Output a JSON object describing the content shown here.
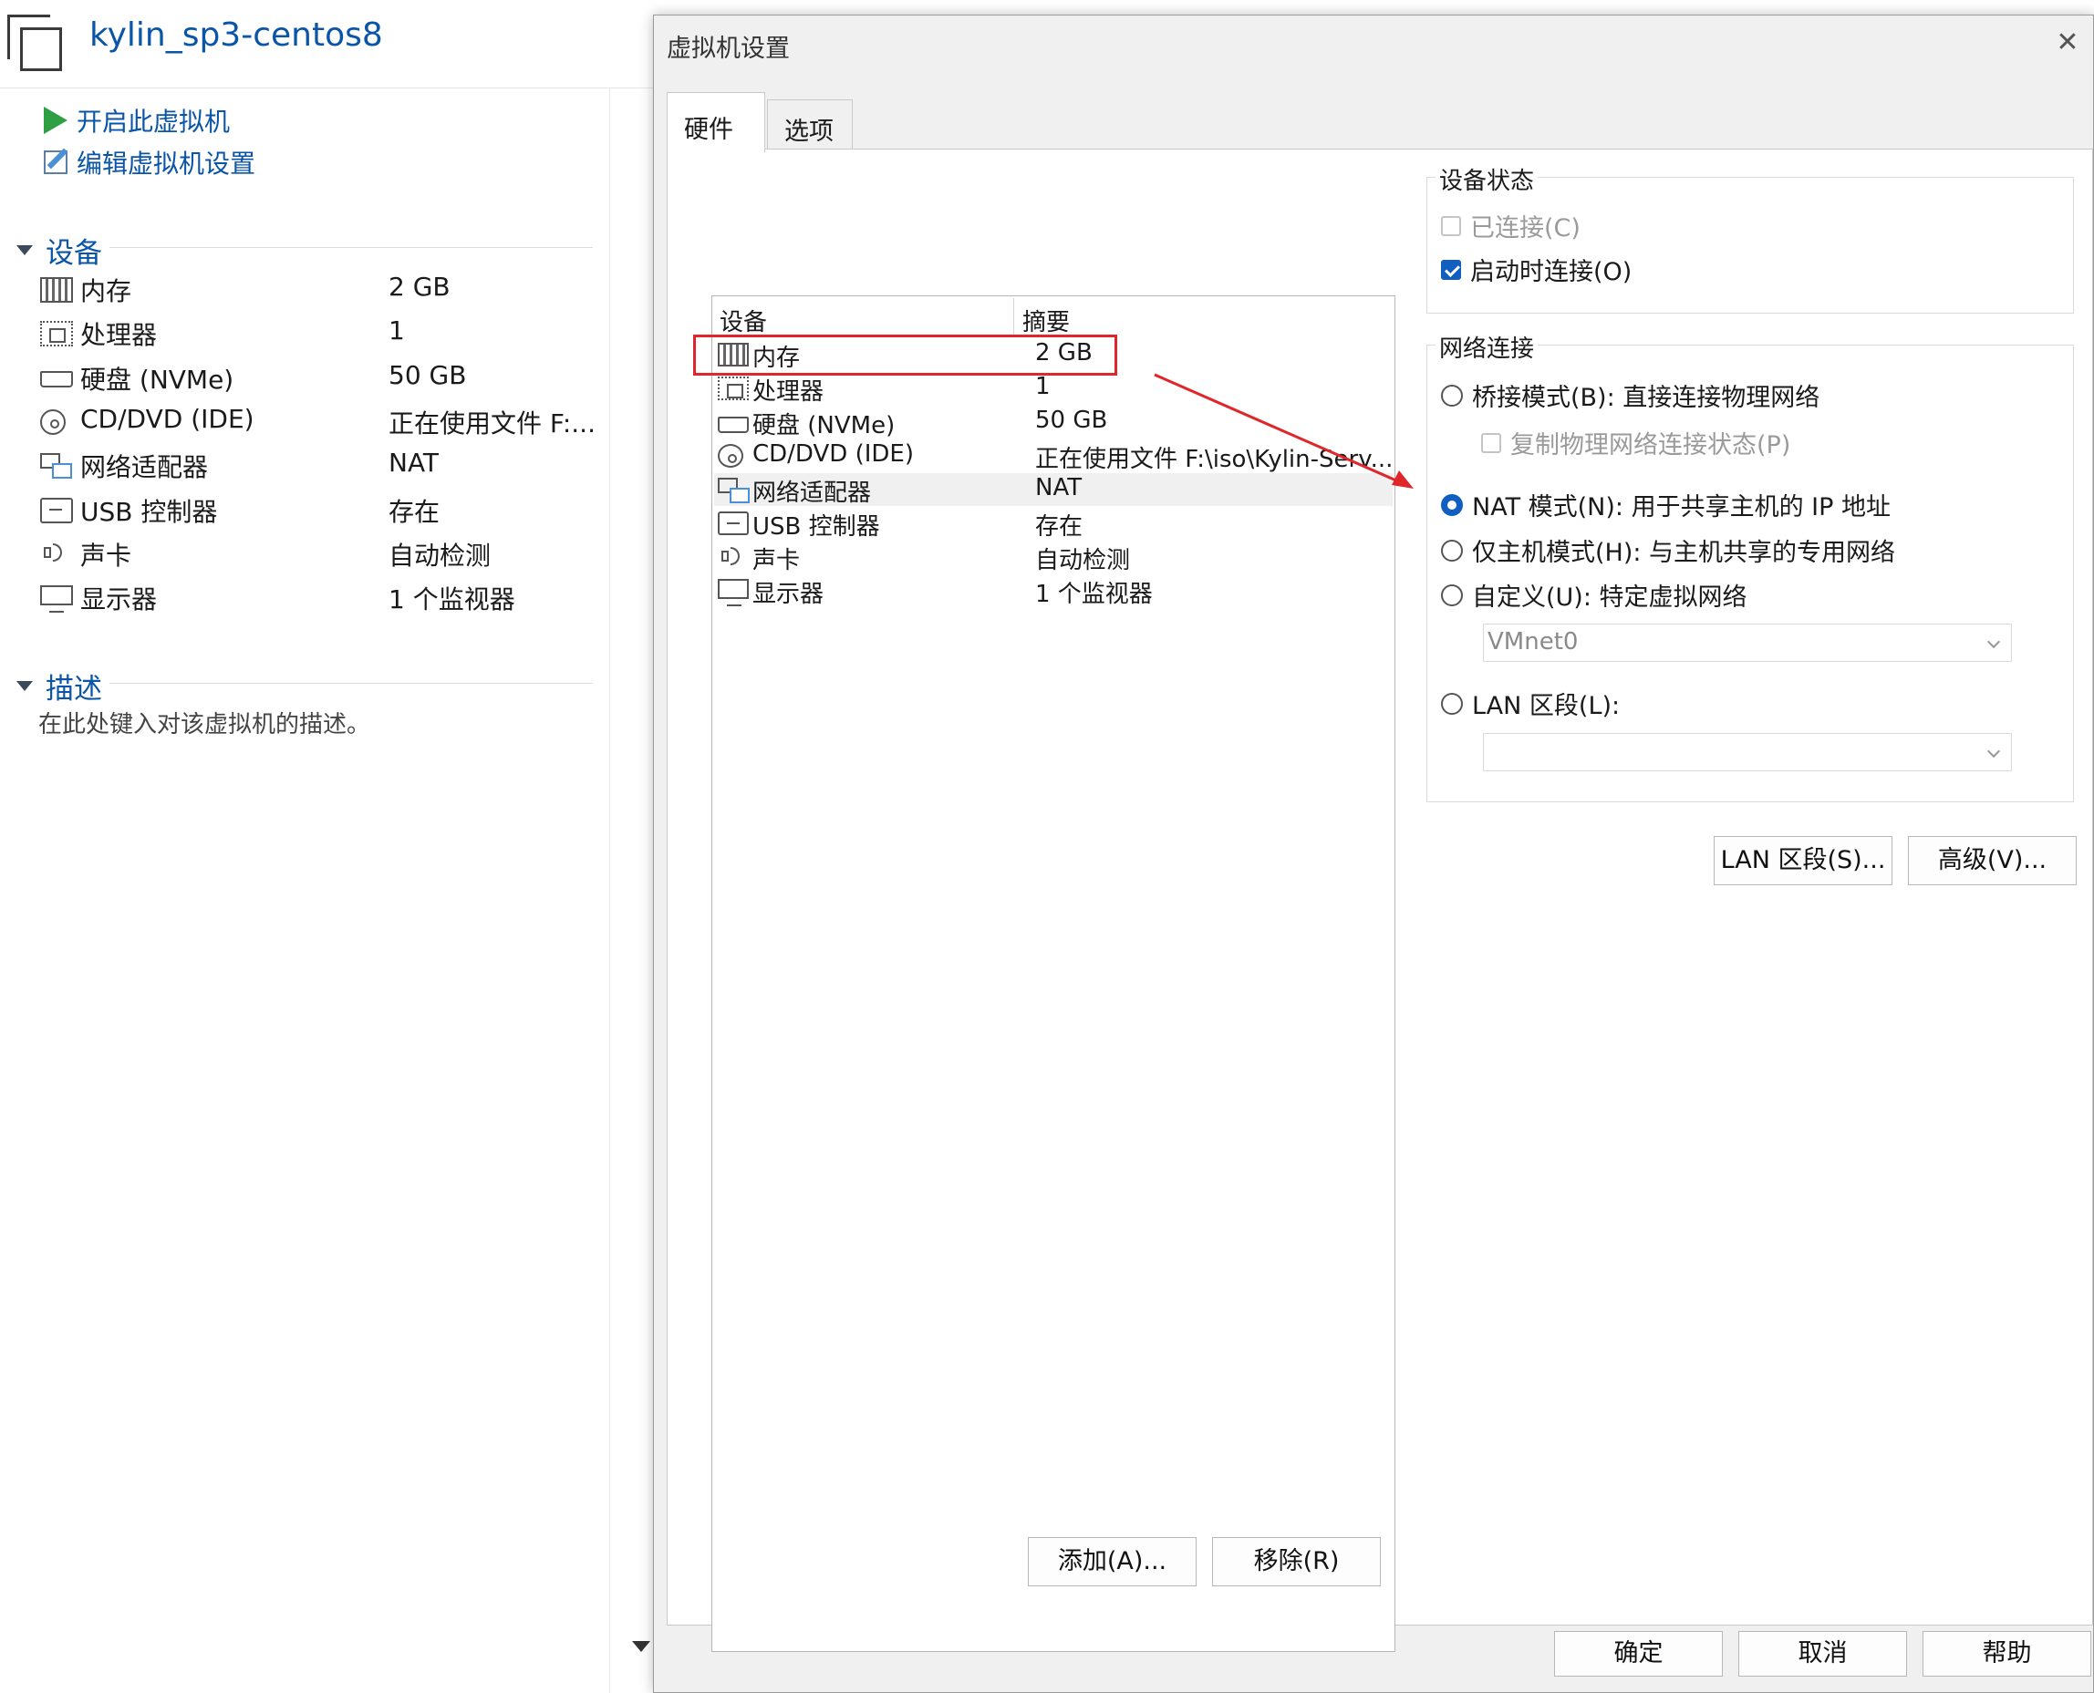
{
  "vm": {
    "title": "kylin_sp3-centos8",
    "actions": {
      "power_on": "开启此虚拟机",
      "edit_settings": "编辑虚拟机设置"
    }
  },
  "left": {
    "devices_heading": "设备",
    "devices": [
      {
        "icon": "memory-icon",
        "name": "内存",
        "value": "2 GB"
      },
      {
        "icon": "processor-icon",
        "name": "处理器",
        "value": "1"
      },
      {
        "icon": "hard-disk-icon",
        "name": "硬盘 (NVMe)",
        "value": "50 GB"
      },
      {
        "icon": "cd-dvd-icon",
        "name": "CD/DVD (IDE)",
        "value": "正在使用文件 F:..."
      },
      {
        "icon": "network-adapter-icon",
        "name": "网络适配器",
        "value": "NAT"
      },
      {
        "icon": "usb-icon",
        "name": "USB 控制器",
        "value": "存在"
      },
      {
        "icon": "sound-card-icon",
        "name": "声卡",
        "value": "自动检测"
      },
      {
        "icon": "display-icon",
        "name": "显示器",
        "value": "1 个监视器"
      }
    ],
    "description_heading": "描述",
    "description_placeholder": "在此处键入对该虚拟机的描述。"
  },
  "dialog": {
    "title": "虚拟机设置",
    "close_glyph": "✕",
    "tabs": [
      {
        "label": "硬件",
        "active": true
      },
      {
        "label": "选项",
        "active": false
      }
    ],
    "device_list": {
      "headers": {
        "device": "设备",
        "summary": "摘要"
      },
      "rows": [
        {
          "icon": "memory-icon",
          "name": "内存",
          "summary": "2 GB",
          "selected": false
        },
        {
          "icon": "processor-icon",
          "name": "处理器",
          "summary": "1",
          "selected": false
        },
        {
          "icon": "hard-disk-icon",
          "name": "硬盘 (NVMe)",
          "summary": "50 GB",
          "selected": false
        },
        {
          "icon": "cd-dvd-icon",
          "name": "CD/DVD (IDE)",
          "summary": "正在使用文件 F:\\iso\\Kylin-Serv...",
          "selected": false
        },
        {
          "icon": "network-adapter-icon",
          "name": "网络适配器",
          "summary": "NAT",
          "selected": true
        },
        {
          "icon": "usb-icon",
          "name": "USB 控制器",
          "summary": "存在",
          "selected": false
        },
        {
          "icon": "sound-card-icon",
          "name": "声卡",
          "summary": "自动检测",
          "selected": false
        },
        {
          "icon": "display-icon",
          "name": "显示器",
          "summary": "1 个监视器",
          "selected": false
        }
      ]
    },
    "list_buttons": {
      "add": "添加(A)...",
      "remove": "移除(R)"
    },
    "device_status": {
      "title": "设备状态",
      "connected": {
        "label": "已连接(C)",
        "checked": false,
        "enabled": false
      },
      "connect_on_power_on": {
        "label": "启动时连接(O)",
        "checked": true,
        "enabled": true
      }
    },
    "network_connection": {
      "title": "网络连接",
      "bridged": {
        "label": "桥接模式(B): 直接连接物理网络",
        "selected": false
      },
      "replicate_state": {
        "label": "复制物理网络连接状态(P)",
        "checked": false,
        "enabled": false
      },
      "nat": {
        "label": "NAT 模式(N): 用于共享主机的 IP 地址",
        "selected": true
      },
      "host_only": {
        "label": "仅主机模式(H): 与主机共享的专用网络",
        "selected": false
      },
      "custom": {
        "label": "自定义(U): 特定虚拟网络",
        "selected": false,
        "select_value": "VMnet0"
      },
      "lan_segment": {
        "label": "LAN 区段(L):",
        "selected": false,
        "select_value": ""
      }
    },
    "right_buttons": {
      "lan_segments": "LAN 区段(S)...",
      "advanced": "高级(V)..."
    },
    "footer": {
      "ok": "确定",
      "cancel": "取消",
      "help": "帮助"
    },
    "annotation_color": "#e0262a",
    "accent_color": "#0f5ec0"
  }
}
